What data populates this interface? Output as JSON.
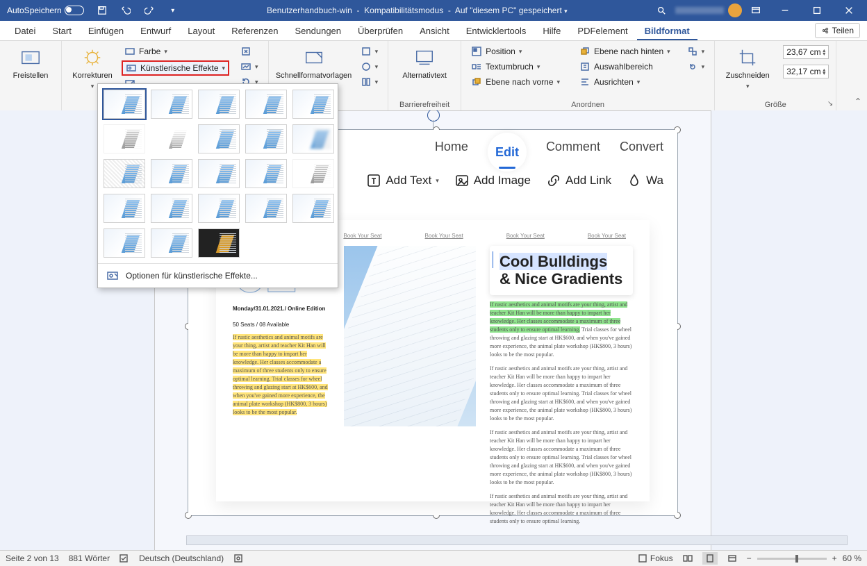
{
  "titlebar": {
    "autosave": "AutoSpeichern",
    "doc": "Benutzerhandbuch-win",
    "mode": "Kompatibilitätsmodus",
    "saved": "Auf \"diesem PC\" gespeichert"
  },
  "menu": {
    "items": [
      "Datei",
      "Start",
      "Einfügen",
      "Entwurf",
      "Layout",
      "Referenzen",
      "Sendungen",
      "Überprüfen",
      "Ansicht",
      "Entwicklertools",
      "Hilfe",
      "PDFelement",
      "Bildformat"
    ],
    "active": "Bildformat",
    "share": "Teilen"
  },
  "ribbon": {
    "freistellen": "Freistellen",
    "korrekturen": "Korrekturen",
    "farbe": "Farbe",
    "effekte": "Künstlerische Effekte",
    "schnell": "Schnellformatvorlagen",
    "alt": "Alternativtext",
    "position": "Position",
    "textumbruch": "Textumbruch",
    "ebene_vorne": "Ebene nach vorne",
    "ebene_hinten": "Ebene nach hinten",
    "auswahl": "Auswahlbereich",
    "ausrichten": "Ausrichten",
    "zuschneiden": "Zuschneiden",
    "h": "23,67 cm",
    "w": "32,17 cm",
    "grp_barriere": "Barrierefreiheit",
    "grp_anordnen": "Anordnen",
    "grp_groesse": "Größe",
    "gallery_footer": "Optionen für künstlerische Effekte..."
  },
  "shot": {
    "tabs": {
      "home": "Home",
      "edit": "Edit",
      "comment": "Comment",
      "convert": "Convert"
    },
    "tools": {
      "addtext": "Add Text",
      "addimage": "Add Image",
      "addlink": "Add Link",
      "watermark": "Wa"
    },
    "seat": "Book Your Seat",
    "headline_l1": "Cool Bulldings",
    "headline_l2": "& Nice Gradients",
    "meta_l1": "Monday/31.01.2021./ Online Edition",
    "meta_l2": "50 Seats / 08 Available",
    "para_left": "If rustic aesthetics and animal motifs are your thing, artist and teacher Kit Han will be more than happy to impart her knowledge. Her classes accommodate a maximum of three students only to ensure optimal learning. Trial classes for wheel throwing and glazing start at HK$600, and when you've gained more experience, the animal plate workshop (HK$800, 3 hours) looks to be the most popular.",
    "para_g": "If rustic aesthetics and animal motifs are your thing, artist and teacher Kit Han will be more than happy to impart her knowledge. Her classes accommodate a maximum of three students only to ensure optimal learning.",
    "para_tail": " Trial classes for wheel throwing and glazing start at HK$600, and when you've gained more experience, the animal plate workshop (HK$800, 3 hours) looks to be the most popular.",
    "para_plain": "If rustic aesthetics and animal motifs are your thing, artist and teacher Kit Han will be more than happy to impart her knowledge. Her classes accommodate a maximum of three students only to ensure optimal learning. Trial classes for wheel throwing and glazing start at HK$600, and when you've gained more experience, the animal plate workshop (HK$800, 3 hours) looks to be the most popular.",
    "para_short": "If rustic aesthetics and animal motifs are your thing, artist and teacher Kit Han will be more than happy to impart her knowledge. Her classes accommodate a maximum of three students only to ensure optimal learning."
  },
  "status": {
    "page": "Seite 2 von 13",
    "words": "881 Wörter",
    "lang": "Deutsch (Deutschland)",
    "focus": "Fokus",
    "zoom": "60 %"
  }
}
